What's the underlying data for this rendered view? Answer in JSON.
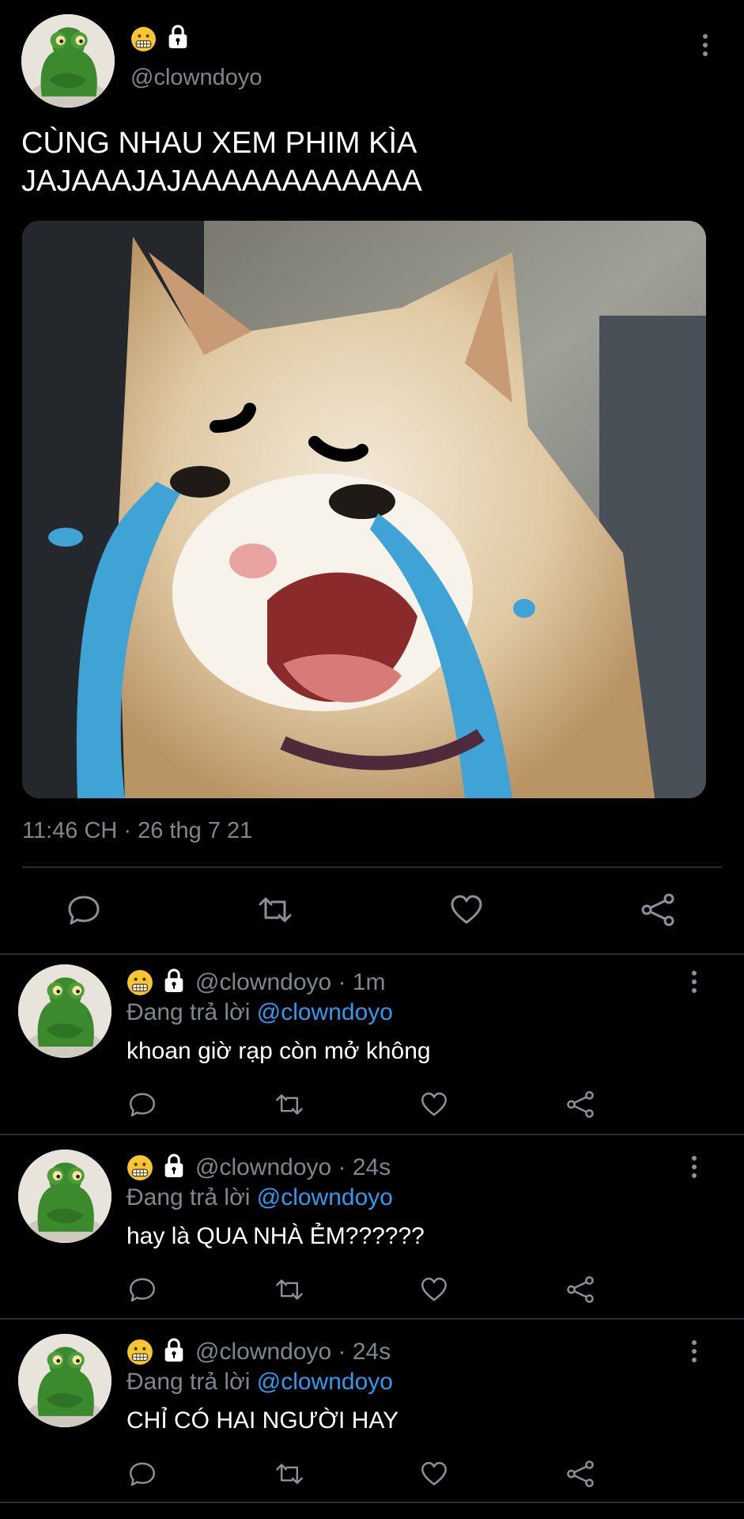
{
  "main_tweet": {
    "handle": "@clowndoyo",
    "text_line1": "CÙNG NHAU XEM PHIM KÌA",
    "text_line2": "JAJAAAJAJAAAAAAAAAAAA",
    "timestamp": "11:46 CH · 26 thg 7 21",
    "image_alt": "crying-cat-meme"
  },
  "replies": [
    {
      "meta": "@clowndoyo · 1m",
      "reply_prefix": "Đang trả lời",
      "reply_to": "@clowndoyo",
      "text": "khoan giờ rạp còn mở không"
    },
    {
      "meta": "@clowndoyo · 24s",
      "reply_prefix": "Đang trả lời",
      "reply_to": "@clowndoyo",
      "text": "hay là QUA NHÀ ẺM??????"
    },
    {
      "meta": "@clowndoyo · 24s",
      "reply_prefix": "Đang trả lời",
      "reply_to": "@clowndoyo",
      "text": "CHỈ CÓ HAI NGƯỜI HAY"
    }
  ],
  "icons": [
    "grimace-emoji-icon",
    "lock-icon",
    "more-icon",
    "reply-icon",
    "retweet-icon",
    "like-icon",
    "share-icon"
  ],
  "colors": {
    "background": "#000000",
    "mention": "#2f9bf0",
    "muted": "#7f868d",
    "divider": "#2a2e33"
  }
}
